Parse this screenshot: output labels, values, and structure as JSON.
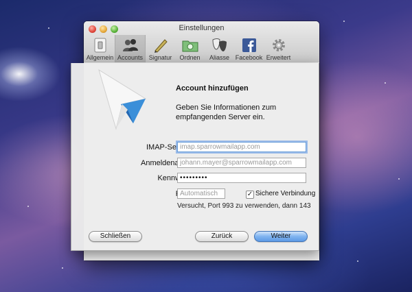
{
  "window": {
    "title": "Einstellungen"
  },
  "toolbar": {
    "items": [
      {
        "label": "Allgemein",
        "icon": "general-switch-icon"
      },
      {
        "label": "Accounts",
        "icon": "accounts-people-icon",
        "active": true
      },
      {
        "label": "Signatur",
        "icon": "signature-pen-icon"
      },
      {
        "label": "Ordnen",
        "icon": "folder-icon"
      },
      {
        "label": "Aliasse",
        "icon": "masks-icon"
      },
      {
        "label": "Facebook",
        "icon": "facebook-icon"
      },
      {
        "label": "Erweitert",
        "icon": "gear-icon"
      }
    ]
  },
  "sheet": {
    "title": "Account hinzufügen",
    "description": "Geben Sie Informationen zum empfangenden Server ein.",
    "imap_label": "IMAP-Server:",
    "imap_placeholder": "imap.sparrowmailapp.com",
    "username_label": "Anmeldename:",
    "username_placeholder": "johann.mayer@sparrowmailapp.com",
    "password_label": "Kennwort:",
    "password_value": "•••••••••",
    "port_label": "Port:",
    "port_placeholder": "Automatisch",
    "secure_label": "Sichere Verbindung",
    "secure_checked": true,
    "hint": "Versucht, Port 993 zu verwenden, dann 143",
    "close_button": "Schließen",
    "back_button": "Zurück",
    "next_button": "Weiter"
  },
  "colors": {
    "accent": "#5d9ae6",
    "logo_blue": "#3b8fd9"
  }
}
